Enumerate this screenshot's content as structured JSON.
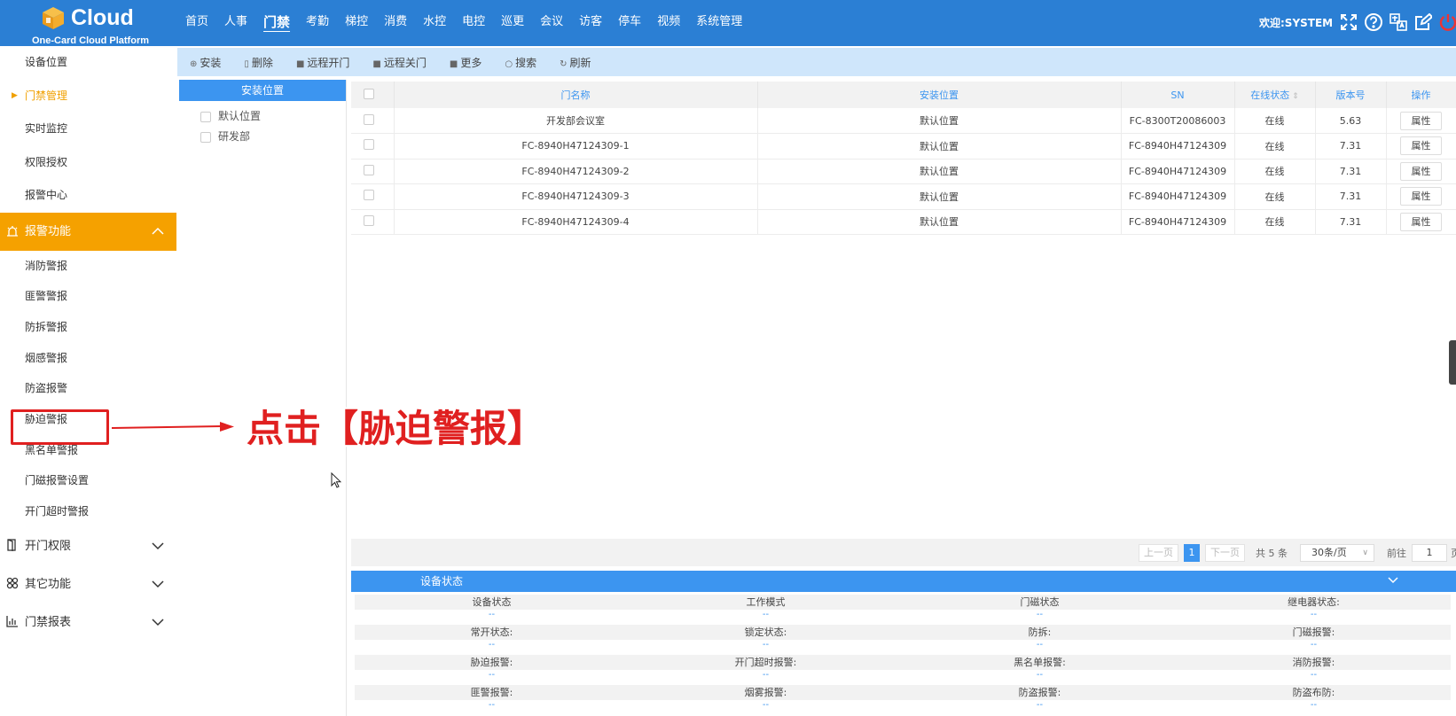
{
  "header": {
    "logo_text": "Cloud",
    "logo_subtitle": "One-Card Cloud Platform",
    "nav": [
      {
        "label": "首页",
        "active": false
      },
      {
        "label": "人事",
        "active": false
      },
      {
        "label": "门禁",
        "active": true
      },
      {
        "label": "考勤",
        "active": false
      },
      {
        "label": "梯控",
        "active": false
      },
      {
        "label": "消费",
        "active": false
      },
      {
        "label": "水控",
        "active": false
      },
      {
        "label": "电控",
        "active": false
      },
      {
        "label": "巡更",
        "active": false
      },
      {
        "label": "会议",
        "active": false
      },
      {
        "label": "访客",
        "active": false
      },
      {
        "label": "停车",
        "active": false
      },
      {
        "label": "视频",
        "active": false
      },
      {
        "label": "系统管理",
        "active": false
      }
    ],
    "welcome": "欢迎:SYSTEM",
    "icons": [
      "fullscreen-icon",
      "help-icon",
      "translate-icon",
      "edit-icon",
      "power-icon"
    ]
  },
  "sidebar": {
    "items": [
      {
        "label": "设备位置",
        "active": false
      },
      {
        "label": "门禁管理",
        "active": true
      },
      {
        "label": "实时监控",
        "active": false
      },
      {
        "label": "权限授权",
        "active": false
      },
      {
        "label": "报警中心",
        "active": false
      }
    ],
    "alarm_group": {
      "label": "报警功能",
      "icon": "alarm-icon",
      "items": [
        "消防警报",
        "匪警警报",
        "防拆警报",
        "烟感警报",
        "防盗报警",
        "胁迫警报",
        "黑名单警报",
        "门磁报警设置",
        "开门超时警报"
      ]
    },
    "groups": [
      {
        "label": "开门权限",
        "icon": "door-icon"
      },
      {
        "label": "其它功能",
        "icon": "grid-icon"
      },
      {
        "label": "门禁报表",
        "icon": "report-icon"
      }
    ]
  },
  "annotation": {
    "text": "点击【胁迫警报】",
    "color": "#e02020"
  },
  "toolbar": [
    {
      "label": "安装",
      "icon": "install-icon"
    },
    {
      "label": "删除",
      "icon": "delete-icon"
    },
    {
      "label": "远程开门",
      "icon": "remote-open-icon"
    },
    {
      "label": "远程关门",
      "icon": "remote-close-icon"
    },
    {
      "label": "更多",
      "icon": "more-icon"
    },
    {
      "label": "搜索",
      "icon": "search-icon"
    },
    {
      "label": "刷新",
      "icon": "refresh-icon"
    }
  ],
  "location_panel": {
    "title": "安装位置",
    "items": [
      "默认位置",
      "研发部"
    ]
  },
  "table": {
    "headers": [
      "门名称",
      "安装位置",
      "SN",
      "在线状态",
      "版本号",
      "操作"
    ],
    "rows": [
      {
        "name": "开发部会议室",
        "location": "默认位置",
        "sn": "FC-8300T20086003",
        "status": "在线",
        "version": "5.63",
        "action": "属性"
      },
      {
        "name": "FC-8940H47124309-1",
        "location": "默认位置",
        "sn": "FC-8940H47124309",
        "status": "在线",
        "version": "7.31",
        "action": "属性"
      },
      {
        "name": "FC-8940H47124309-2",
        "location": "默认位置",
        "sn": "FC-8940H47124309",
        "status": "在线",
        "version": "7.31",
        "action": "属性"
      },
      {
        "name": "FC-8940H47124309-3",
        "location": "默认位置",
        "sn": "FC-8940H47124309",
        "status": "在线",
        "version": "7.31",
        "action": "属性"
      },
      {
        "name": "FC-8940H47124309-4",
        "location": "默认位置",
        "sn": "FC-8940H47124309",
        "status": "在线",
        "version": "7.31",
        "action": "属性"
      }
    ]
  },
  "pager": {
    "prev": "上一页",
    "current": "1",
    "next": "下一页",
    "total": "共 5 条",
    "page_size": "30条/页",
    "goto_label": "前往",
    "goto_value": "1",
    "page_suffix": "页"
  },
  "device_status": {
    "title": "设备状态",
    "rows": [
      [
        "设备状态",
        "工作模式",
        "门磁状态",
        "继电器状态:"
      ],
      [
        "常开状态:",
        "锁定状态:",
        "防拆:",
        "门磁报警:"
      ],
      [
        "胁迫报警:",
        "开门超时报警:",
        "黑名单报警:",
        "消防报警:"
      ],
      [
        "匪警报警:",
        "烟雾报警:",
        "防盗报警:",
        "防盗布防:"
      ]
    ],
    "value_placeholder": "--"
  },
  "colors": {
    "header_bg": "#2b7fd4",
    "accent": "#3c95f0",
    "sidebar_active": "#f5a100",
    "online": "#1a9a1a"
  }
}
